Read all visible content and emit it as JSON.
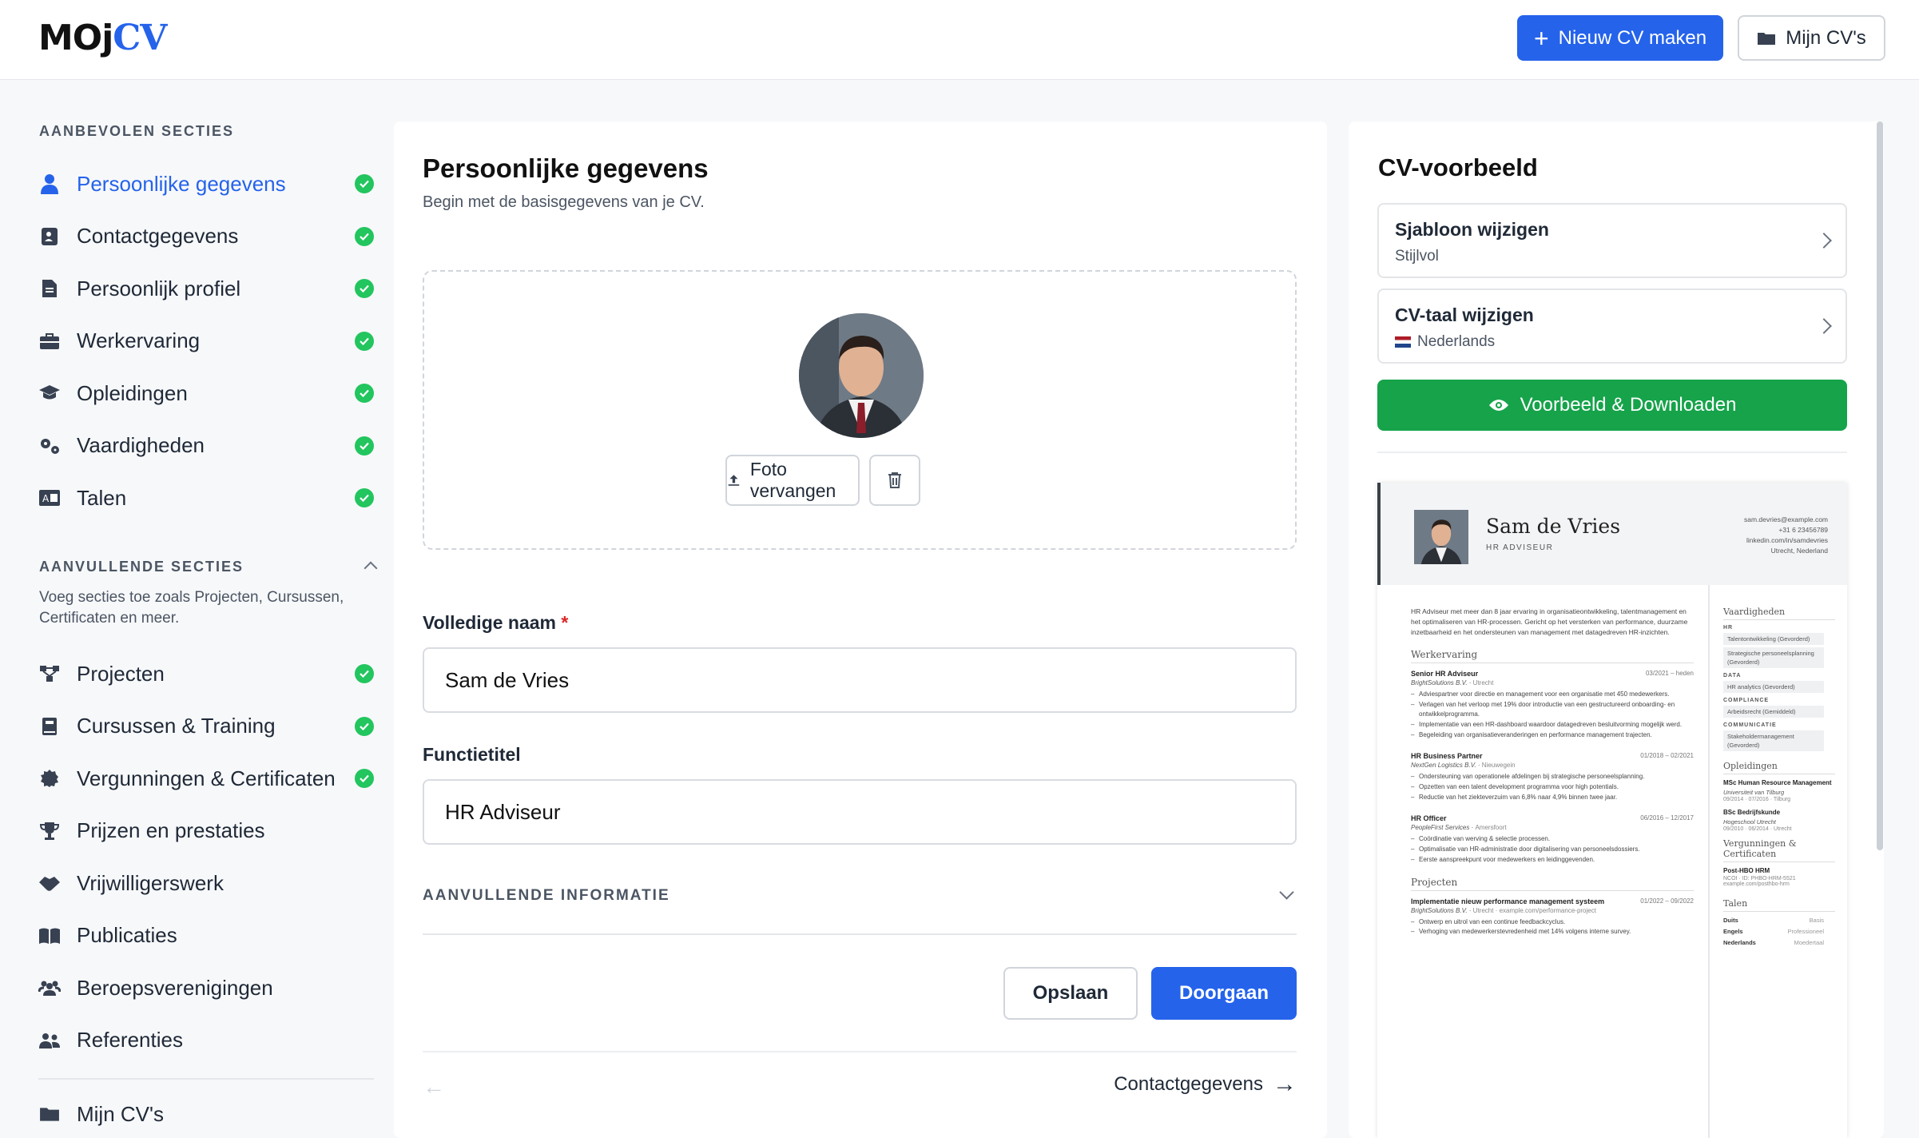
{
  "app": {
    "logo_a": "MOj",
    "logo_b": "CV"
  },
  "header": {
    "new_cv": "Nieuw CV maken",
    "my_cvs": "Mijn CV's"
  },
  "sidebar": {
    "recommended_title": "AANBEVOLEN SECTIES",
    "recommended": [
      {
        "label": "Persoonlijke gegevens",
        "icon": "user-icon",
        "done": true,
        "active": true
      },
      {
        "label": "Contactgegevens",
        "icon": "contact-card-icon",
        "done": true
      },
      {
        "label": "Persoonlijk profiel",
        "icon": "document-icon",
        "done": true
      },
      {
        "label": "Werkervaring",
        "icon": "briefcase-icon",
        "done": true
      },
      {
        "label": "Opleidingen",
        "icon": "graduation-cap-icon",
        "done": true
      },
      {
        "label": "Vaardigheden",
        "icon": "gears-icon",
        "done": true
      },
      {
        "label": "Talen",
        "icon": "language-icon",
        "done": true
      }
    ],
    "additional_title": "AANVULLENDE SECTIES",
    "additional_desc": "Voeg secties toe zoals Projecten, Cursussen, Certificaten en meer.",
    "additional": [
      {
        "label": "Projecten",
        "icon": "diagram-icon",
        "done": true
      },
      {
        "label": "Cursussen & Training",
        "icon": "book-icon",
        "done": true
      },
      {
        "label": "Vergunningen & Certificaten",
        "icon": "certificate-icon",
        "done": true
      },
      {
        "label": "Prijzen en prestaties",
        "icon": "trophy-icon",
        "done": false
      },
      {
        "label": "Vrijwilligerswerk",
        "icon": "handshake-icon",
        "done": false
      },
      {
        "label": "Publicaties",
        "icon": "open-book-icon",
        "done": false
      },
      {
        "label": "Beroepsverenigingen",
        "icon": "people-icon",
        "done": false
      },
      {
        "label": "Referenties",
        "icon": "users-icon",
        "done": false
      }
    ],
    "footer_item": "Mijn CV's"
  },
  "form": {
    "title": "Persoonlijke gegevens",
    "subtitle": "Begin met de basisgegevens van je CV.",
    "replace_photo": "Foto vervangen",
    "name_label": "Volledige naam",
    "required_mark": "*",
    "name_value": "Sam de Vries",
    "job_label": "Functietitel",
    "job_value": "HR Adviseur",
    "extra_info": "AANVULLENDE INFORMATIE",
    "save": "Opslaan",
    "continue": "Doorgaan",
    "next_link": "Contactgegevens"
  },
  "preview": {
    "title": "CV-voorbeeld",
    "template_title": "Sjabloon wijzigen",
    "template_value": "Stijlvol",
    "lang_title": "CV-taal wijzigen",
    "lang_value": "Nederlands",
    "download": "Voorbeeld & Downloaden",
    "accent": "#16a34a"
  },
  "cv": {
    "name": "Sam de Vries",
    "role": "HR ADVISEUR",
    "contact": [
      "sam.devries@example.com",
      "+31 6 23456789",
      "linkedin.com/in/samdevries",
      "Utrecht, Nederland"
    ],
    "summary": "HR Adviseur met meer dan 8 jaar ervaring in organisatieontwikkeling, talentmanagement en het optimaliseren van HR-processen. Gericht op het versterken van performance, duurzame inzetbaarheid en het ondersteunen van management met datagedreven HR-inzichten.",
    "work_title": "Werkervaring",
    "jobs": [
      {
        "title": "Senior HR Adviseur",
        "dates": "03/2021 – heden",
        "company": "BrightSolutions B.V.",
        "loc": "Utrecht",
        "bullets": [
          "Adviespartner voor directie en management voor een organisatie met 450 medewerkers.",
          "Verlagen van het verloop met 19% door introductie van een gestructureerd onboarding- en ontwikkelprogramma.",
          "Implementatie van een HR-dashboard waardoor datagedreven besluitvorming mogelijk werd.",
          "Begeleiding van organisatieveranderingen en performance management trajecten."
        ]
      },
      {
        "title": "HR Business Partner",
        "dates": "01/2018 – 02/2021",
        "company": "NextGen Logistics B.V.",
        "loc": "Nieuwegein",
        "bullets": [
          "Ondersteuning van operationele afdelingen bij strategische personeelsplanning.",
          "Opzetten van een talent development programma voor high potentials.",
          "Reductie van het ziekteverzuim van 6,8% naar 4,9% binnen twee jaar."
        ]
      },
      {
        "title": "HR Officer",
        "dates": "06/2016 – 12/2017",
        "company": "PeopleFirst Services",
        "loc": "Amersfoort",
        "bullets": [
          "Coördinatie van werving & selectie processen.",
          "Optimalisatie van HR-administratie door digitalisering van personeelsdossiers.",
          "Eerste aanspreekpunt voor medewerkers en leidinggevenden."
        ]
      }
    ],
    "projects_title": "Projecten",
    "project": {
      "title": "Implementatie nieuw performance management systeem",
      "dates": "01/2022 – 09/2022",
      "company": "BrightSolutions B.V.",
      "loc": "Utrecht · example.com/performance-project",
      "bullets": [
        "Ontwerp en uitrol van een continue feedbackcyclus.",
        "Verhoging van medewerkerstevredenheid met 14% volgens interne survey."
      ]
    },
    "skills_title": "Vaardigheden",
    "skill_groups": [
      {
        "group": "HR",
        "items": [
          "Talentontwikkeling (Gevorderd)",
          "Strategische personeelsplanning (Gevorderd)"
        ]
      },
      {
        "group": "DATA",
        "items": [
          "HR analytics (Gevorderd)"
        ]
      },
      {
        "group": "COMPLIANCE",
        "items": [
          "Arbeidsrecht (Gemiddeld)"
        ]
      },
      {
        "group": "COMMUNICATIE",
        "items": [
          "Stakeholdermanagement (Gevorderd)"
        ]
      }
    ],
    "edu_title": "Opleidingen",
    "edu": [
      {
        "degree": "MSc Human Resource Management",
        "school": "Universiteit van Tilburg",
        "meta": "09/2014 · 07/2016 · Tilburg"
      },
      {
        "degree": "BSc Bedrijfskunde",
        "school": "Hogeschool Utrecht",
        "meta": "09/2010 · 06/2014 · Utrecht"
      }
    ],
    "cert_title": "Vergunningen & Certificaten",
    "cert": {
      "name": "Post-HBO HRM",
      "meta": "NCOI · ID: PHBO-HRM-5521",
      "link": "example.com/posthbo-hrm"
    },
    "lang_title": "Talen",
    "langs": [
      {
        "l": "Duits",
        "v": "Basis"
      },
      {
        "l": "Engels",
        "v": "Professioneel"
      },
      {
        "l": "Nederlands",
        "v": "Moedertaal"
      }
    ]
  }
}
